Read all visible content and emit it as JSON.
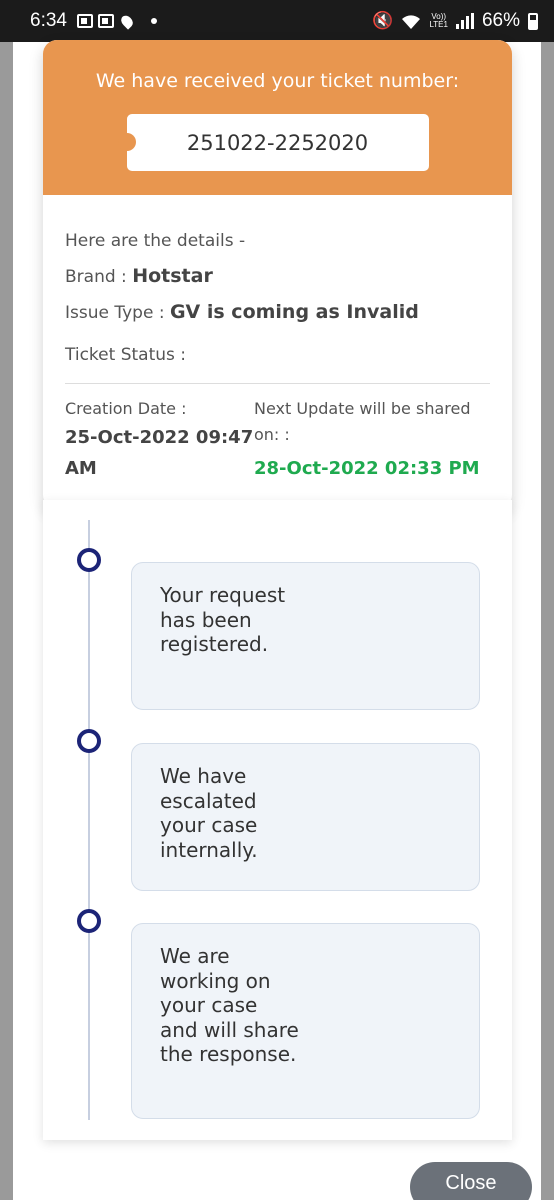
{
  "status_bar": {
    "time": "6:34",
    "battery": "66%",
    "network": "LTE1",
    "volte": "Vo))",
    "icons": [
      "outlook-icon",
      "outlook-icon",
      "location-icon",
      "dot-icon",
      "mute-icon",
      "wifi-icon",
      "signal-icon",
      "battery-icon"
    ]
  },
  "header": {
    "received_text": "We have received your ticket number:",
    "ticket_number": "251022-2252020"
  },
  "details": {
    "intro": "Here are the details -",
    "brand_label": "Brand :",
    "brand_value": "Hotstar",
    "issue_label": "Issue Type :",
    "issue_value": "GV is coming as Invalid",
    "status_label": "Ticket Status :",
    "creation_label": "Creation Date :",
    "creation_value": "25-Oct-2022 09:47 AM",
    "next_update_label": "Next Update will be shared on: :",
    "next_update_value": "28-Oct-2022 02:33 PM"
  },
  "timeline": [
    {
      "text": "Your request has been registered."
    },
    {
      "text": "We have escalated your case internally."
    },
    {
      "text": "We are working on your case and will share the response."
    }
  ],
  "actions": {
    "close_label": "Close"
  },
  "colors": {
    "header_orange": "#e8964f",
    "green": "#1faa4f",
    "timeline_navy": "#1c2477",
    "close_bg": "#6b7179"
  }
}
